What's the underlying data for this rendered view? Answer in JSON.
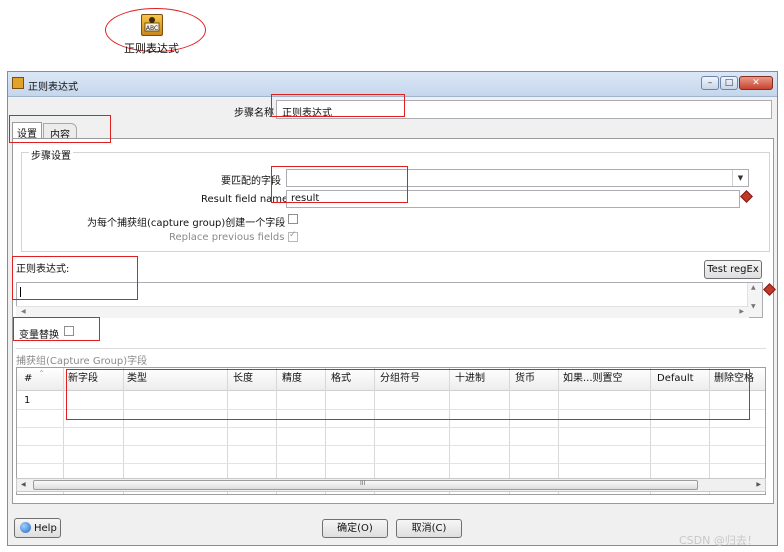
{
  "step_icon": {
    "caption": "正则表达式",
    "icon": "regex-step-icon"
  },
  "window": {
    "title": "正则表达式",
    "controls": {
      "minimize": "–",
      "maximize": "□",
      "close": "✕"
    }
  },
  "step_name": {
    "label": "步骤名称",
    "value": "正则表达式"
  },
  "tabs": [
    {
      "label": "设置"
    },
    {
      "label": "内容"
    }
  ],
  "settings_group": {
    "title": "步骤设置"
  },
  "field_to_match": {
    "label": "要匹配的字段",
    "value": ""
  },
  "result_field": {
    "label": "Result field name",
    "value": "result"
  },
  "create_per_group": {
    "label": "为每个捕获组(capture group)创建一个字段",
    "checked": false
  },
  "replace_previous": {
    "label": "Replace previous fields",
    "checked": true
  },
  "regex": {
    "label": "正则表达式:",
    "value": "",
    "test_button": "Test regEx"
  },
  "variable_substitution": {
    "label": "变量替换",
    "checked": false
  },
  "capture_group": {
    "title": "捕获组(Capture Group)字段",
    "columns": [
      "#",
      "新字段",
      "类型",
      "长度",
      "精度",
      "格式",
      "分组符号",
      "十进制",
      "货币",
      "如果...则置空",
      "Default",
      "删除空格"
    ],
    "rows": [
      {
        "num": "1"
      }
    ],
    "scrollbar_grip": "III"
  },
  "buttons": {
    "help": "Help",
    "ok": "确定(O)",
    "cancel": "取消(C)"
  },
  "watermark": "CSDN @归去！"
}
